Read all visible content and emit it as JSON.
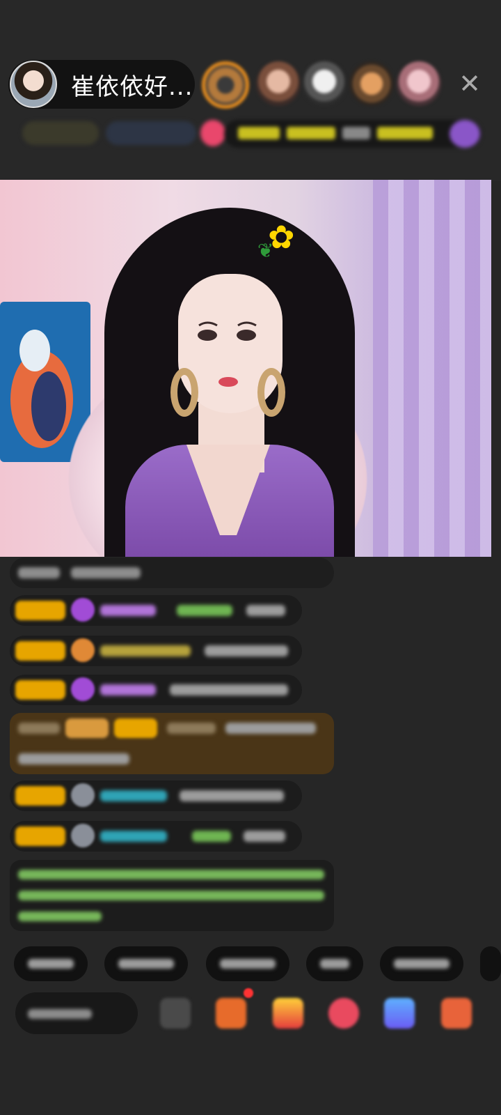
{
  "host": {
    "name": "崔依依好...",
    "avatar_icon": "host-avatar"
  },
  "viewers": [
    "viewer-avatar-1",
    "viewer-avatar-2",
    "viewer-avatar-3",
    "viewer-avatar-4",
    "viewer-avatar-5"
  ],
  "close": {
    "label": "✕"
  },
  "colors": {
    "background": "#262626",
    "badge_gold": "#e7a500",
    "highlight_brown": "#4a3517",
    "green_text": "#77b75a",
    "cyan_name": "#2fa3b5",
    "purple_icon": "#a14cd6"
  },
  "video": {
    "description_icon": "live-stream-video"
  },
  "chat": {
    "messages": [
      "blurred",
      "blurred",
      "blurred",
      "blurred",
      "blurred",
      "blurred",
      "blurred"
    ]
  },
  "bottom": {
    "tools": [
      "emoji-icon",
      "gift-box-icon",
      "gift-bag-icon",
      "heart-chat-icon",
      "share-icon",
      "game-icon"
    ]
  }
}
